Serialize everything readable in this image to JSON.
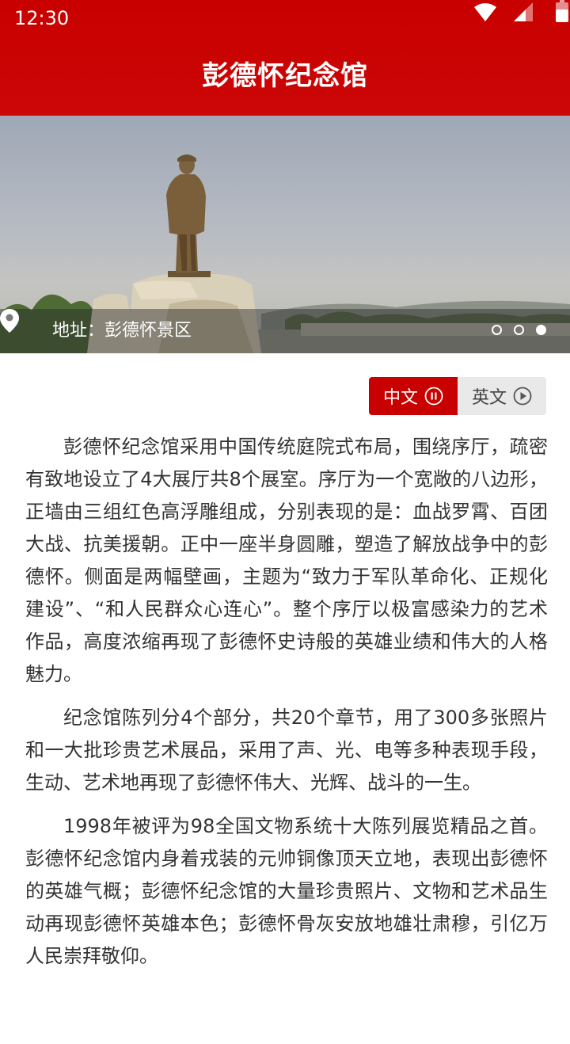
{
  "status_bar": {
    "time": "12:30",
    "icons": [
      "wifi-icon",
      "signal-icon",
      "battery-icon"
    ]
  },
  "header": {
    "title": "彭德怀纪念馆",
    "color": "#c80000"
  },
  "hero": {
    "address_label": "地址：彭德怀景区",
    "pin_icon": "location-pin-icon",
    "slide_count": 3,
    "active_slide": 3
  },
  "language_toggle": {
    "chinese_label": "中文",
    "chinese_icon": "pause-icon",
    "english_label": "英文",
    "english_icon": "play-icon",
    "active": "中文",
    "active_color": "#c80000"
  },
  "article": {
    "paragraphs": [
      "彭德怀纪念馆采用中国传统庭院式布局，围绕序厅，疏密有致地设立了4大展厅共8个展室。序厅为一个宽敞的八边形，正墙由三组红色高浮雕组成，分别表现的是：血战罗霄、百团大战、抗美援朝。正中一座半身圆雕，塑造了解放战争中的彭德怀。侧面是两幅壁画，主题为“致力于军队革命化、正规化建设”、“和人民群众心连心”。整个序厅以极富感染力的艺术作品，高度浓缩再现了彭德怀史诗般的英雄业绩和伟大的人格魅力。",
      "纪念馆陈列分4个部分，共20个章节，用了300多张照片和一大批珍贵艺术展品，采用了声、光、电等多种表现手段，生动、艺术地再现了彭德怀伟大、光辉、战斗的一生。",
      "1998年被评为98全国文物系统十大陈列展览精品之首。彭德怀纪念馆内身着戎装的元帅铜像顶天立地，表现出彭德怀的英雄气概；彭德怀纪念馆的大量珍贵照片、文物和艺术品生动再现彭德怀英雄本色；彭德怀骨灰安放地雄壮肃穆，引亿万人民崇拜敬仰。"
    ]
  }
}
